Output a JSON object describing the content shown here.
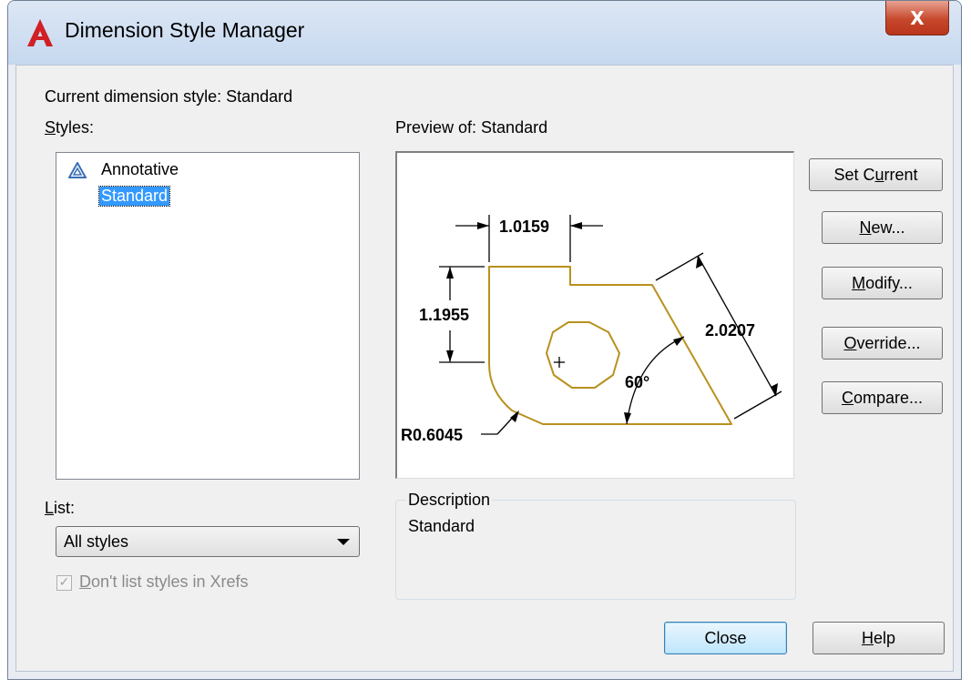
{
  "window": {
    "title": "Dimension Style Manager",
    "close_glyph": "X"
  },
  "current_style_label": "Current dimension style: Standard",
  "styles": {
    "label_accel": "S",
    "label_rest": "tyles:",
    "items": [
      {
        "label": "Annotative",
        "icon": "annotative-icon",
        "selected": false
      },
      {
        "label": "Standard",
        "selected": true
      }
    ]
  },
  "list": {
    "label_accel": "L",
    "label_rest": "ist:",
    "selected": "All styles"
  },
  "xrefs_checkbox": {
    "checked": true,
    "enabled": false,
    "label_pre": "",
    "label_accel": "D",
    "label_rest": "on't list styles in Xrefs"
  },
  "preview": {
    "label": "Preview of: Standard",
    "dims": {
      "top": "1.0159",
      "left": "1.1955",
      "slant": "2.0207",
      "angle": "60°",
      "radius": "R0.6045"
    }
  },
  "description": {
    "legend": "Description",
    "text": "Standard"
  },
  "buttons": {
    "set_current": {
      "pre": "Set C",
      "accel": "u",
      "rest": "rrent"
    },
    "new": {
      "pre": "",
      "accel": "N",
      "rest": "ew..."
    },
    "modify": {
      "pre": "",
      "accel": "M",
      "rest": "odify..."
    },
    "override": {
      "pre": "",
      "accel": "O",
      "rest": "verride..."
    },
    "compare": {
      "pre": "",
      "accel": "C",
      "rest": "ompare..."
    },
    "close": {
      "label": "Close"
    },
    "help": {
      "pre": "",
      "accel": "H",
      "rest": "elp"
    }
  },
  "colors": {
    "geometry": "#b8911e",
    "selection": "#3399ff"
  }
}
